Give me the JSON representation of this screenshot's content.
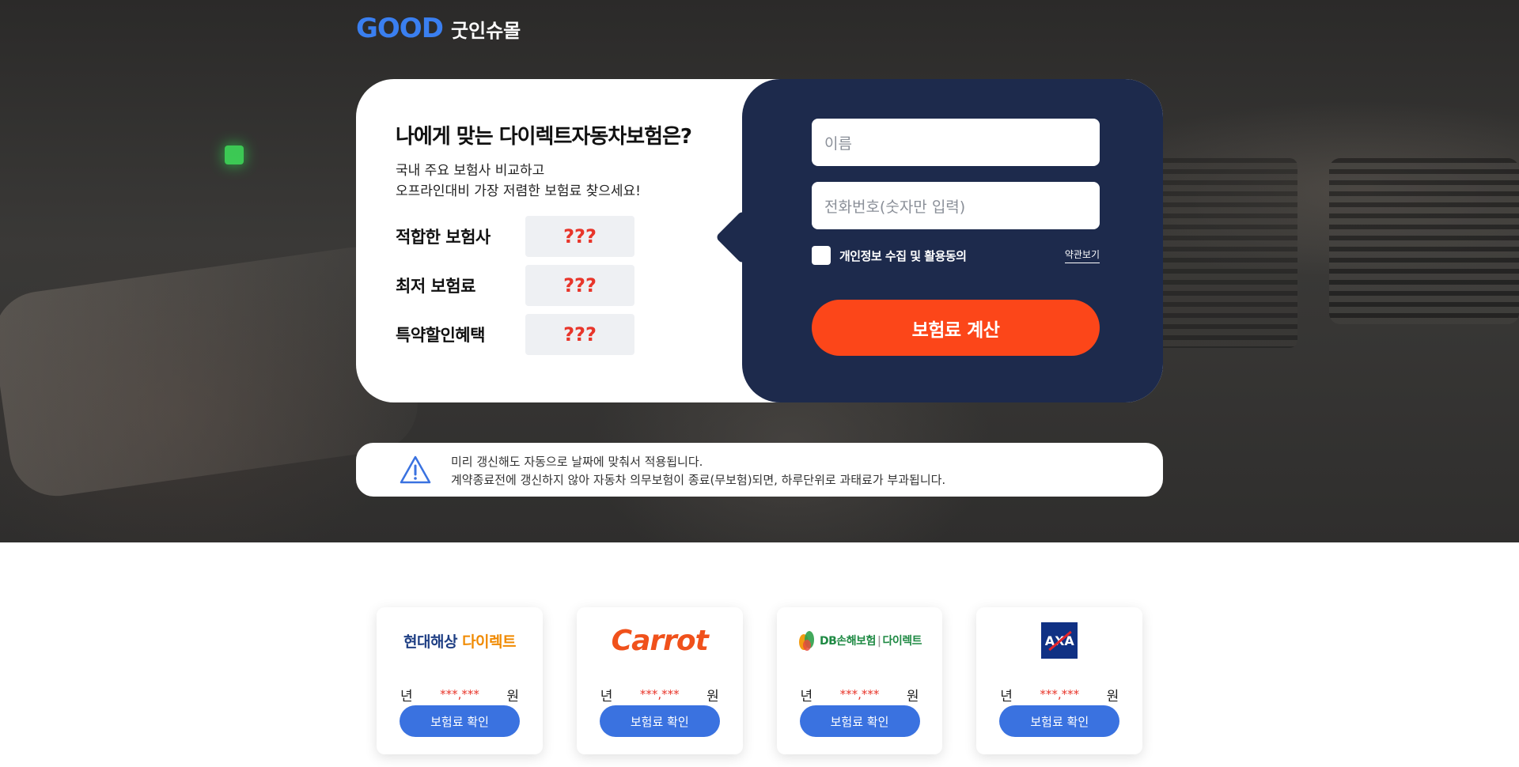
{
  "brand": {
    "logo_en": "GOOD",
    "logo_kr": "굿인슈몰",
    "colors": {
      "accent": "#3a7ff0",
      "navy": "#1d2a4c",
      "cta": "#fc4619",
      "button": "#3a72e0",
      "highlight": "#e8352a"
    }
  },
  "hero": {
    "title": "나에게 맞는 다이렉트자동차보험은?",
    "subtitle_line1": "국내 주요 보험사 비교하고",
    "subtitle_line2": "오프라인대비 가장 저렴한 보험료 찾으세요!",
    "rows": [
      {
        "label": "적합한 보험사",
        "value": "???"
      },
      {
        "label": "최저 보험료",
        "value": "???"
      },
      {
        "label": "특약할인혜택",
        "value": "???"
      }
    ]
  },
  "form": {
    "name_placeholder": "이름",
    "phone_placeholder": "전화번호(숫자만 입력)",
    "agree_label": "개인정보 수집 및 활용동의",
    "terms_link": "약관보기",
    "submit_label": "보험료 계산"
  },
  "notice": {
    "icon": "warning-triangle-icon",
    "line1": "미리 갱신해도 자동으로 날짜에 맞춰서 적용됩니다.",
    "line2": "계약종료전에 갱신하지 않아 자동차 의무보험이 종료(무보험)되면, 하루단위로 과태료가 부과됩니다."
  },
  "insurers": [
    {
      "name_main": "현대해상",
      "name_accent": "다이렉트",
      "year_label": "년",
      "amount": "***,***",
      "unit": "원",
      "button": "보험료 확인"
    },
    {
      "name_main": "Carrot",
      "year_label": "년",
      "amount": "***,***",
      "unit": "원",
      "button": "보험료 확인"
    },
    {
      "name_main": "DB손해보험",
      "name_accent": "다이렉트",
      "separator": "|",
      "year_label": "년",
      "amount": "***,***",
      "unit": "원",
      "button": "보험료 확인"
    },
    {
      "name_main": "AXA",
      "year_label": "년",
      "amount": "***,***",
      "unit": "원",
      "button": "보험료 확인"
    }
  ]
}
